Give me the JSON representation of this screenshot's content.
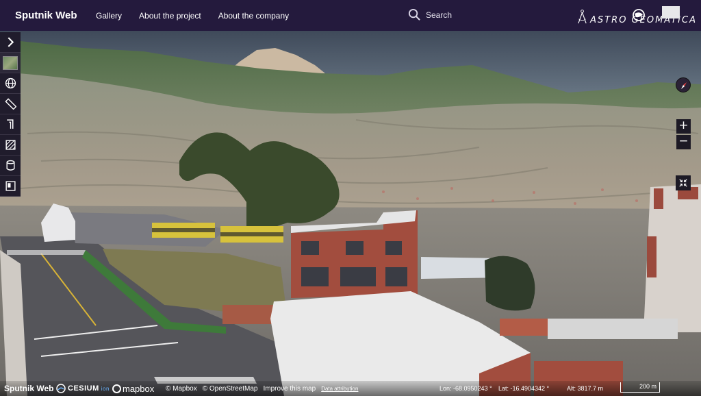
{
  "header": {
    "brand": "Sputnik Web",
    "nav": [
      "Gallery",
      "About the project",
      "About the company"
    ],
    "search_label": "Search",
    "logo_text": "ASTRO GEOMATICA"
  },
  "toolbar": {
    "items": [
      {
        "name": "expand-toolbar-button",
        "icon": "chevron-right-icon"
      },
      {
        "name": "base-layer-button",
        "icon": "map-thumbnail-icon"
      },
      {
        "name": "globe-button",
        "icon": "globe-icon"
      },
      {
        "name": "measure-distance-button",
        "icon": "ruler-icon"
      },
      {
        "name": "measure-height-button",
        "icon": "height-icon"
      },
      {
        "name": "measure-area-button",
        "icon": "area-hatch-icon"
      },
      {
        "name": "measure-volume-button",
        "icon": "cylinder-icon"
      },
      {
        "name": "layers-panel-button",
        "icon": "panel-icon"
      }
    ]
  },
  "controls": {
    "zoom_in": "+",
    "zoom_out": "−"
  },
  "status": {
    "brand": "Sputnik Web",
    "cesium_label": "CESIUM",
    "cesium_suffix": "ion",
    "mapbox_label": "mapbox",
    "attr_mapbox": "© Mapbox",
    "attr_osm": "© OpenStreetMap",
    "attr_improve": "Improve this map",
    "attr_data": "Data attribution",
    "lon": "Lon: -68.0950243 °",
    "lat": "Lat: -16.4904342 °",
    "alt": "Alt: 3817.7 m",
    "scale": "200 m"
  },
  "colors": {
    "header_bg": "#241a3d",
    "toolbar_bg": "#201c2c",
    "sky": "#4d5a6a"
  }
}
